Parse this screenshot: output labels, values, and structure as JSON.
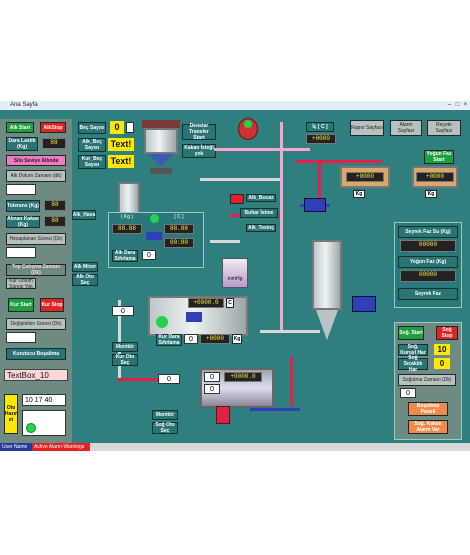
{
  "window": {
    "title": "Ana Sayfa",
    "tab": "Ana Sayfa"
  },
  "left": {
    "alk_start": "Alk Start",
    "alkstop": "AlkStop",
    "silo_seviye": "Silo Seviye Altında",
    "alk_dolum_zamani": "Alk Dolum Zamanı (dk)",
    "dara_lastik": "Dara Lastik (Kg)",
    "tolerans": "Tolerans (Kg)",
    "alinan_kakao": "Alınan Kakao (Kg)",
    "hesaplanan_sure": "Hesaplanan Süresi (Dk)",
    "top_calisma": "Top Çalışma Zamanı (Dk)",
    "kur_dolum": "Kur Dolum Süresi Yok",
    "kur_start": "Kur Start",
    "kur_stop": "Kur Stop",
    "degistirilen_sure": "Değiştirilen Süresi (Dk)",
    "kurutucu": "Kurutucu Boşaltma",
    "textbox": "TextBox_10",
    "oto_hazir": "Oto Hazır et",
    "time": "10 17 40"
  },
  "beg": {
    "beg_sayısı": "Beç Sayısı",
    "beg_val": "0",
    "alk_beg": "Alk_Beç Sayısı",
    "kur_beg": "Kur_Beç Sayısı",
    "text1": "Text!",
    "text2": "Text!"
  },
  "top": {
    "denetar": "Denetar Transfer Start",
    "kakao_istegi": "Kakao İsteği yok",
    "ic_c": "İç [ C ]",
    "rapor": "Rapor Sayfası",
    "alarm": "Alarm Sayfası",
    "recete": "Reçete Sayfası",
    "yogun_faz": "Yoğun Faz Start"
  },
  "mid": {
    "alk_hava": "Alk_Hava",
    "kg": "( Kg )",
    "c": "[ C ]",
    "alk_bucaz": "Alk_Bucaz",
    "buhar_istme": "Buhar İstme",
    "alk_terinc": "Alk_Tesinç",
    "alk_dara": "Alk Dara Sıfırlama",
    "alk_mixer": "Alk Mixer",
    "alk_oto": "Alk Oto Seç",
    "mmhg": "mmHg",
    "val_c": "+0000.0",
    "kur_dara": "Kur Dara Sıfırlama",
    "kur_oto": "Kur Oto Seç",
    "monitor1": "Monitör",
    "monitor2": "Monitör",
    "sog_oto": "Soğ Oto Seç",
    "kg_label": "Kg",
    "c_label": "C"
  },
  "right": {
    "seyrek_faz_su": "Seyrek Faz Su (Kg)",
    "yogun_faz_kg": "Yoğun Faz (Kg)",
    "seyrek_faz": "Seyrek Faz",
    "sog_start": "Soğ. Start",
    "sog_stop": "Soğ Stop",
    "sog_kuruyl": "Soğ. Kuruyl Har",
    "sog_sicaklik": "Soğ Sıcaklık Har",
    "sogutma_zamani": "Soğutma Zamanı (Dk)",
    "bosaltma": "Boşaltma Paneli",
    "sog_kakao": "Soğ. Kakao Alarm Var",
    "val_10": "10",
    "val_0": "0"
  },
  "status": {
    "user": "User Name",
    "alarm": "Active Alarm-Warnings"
  }
}
